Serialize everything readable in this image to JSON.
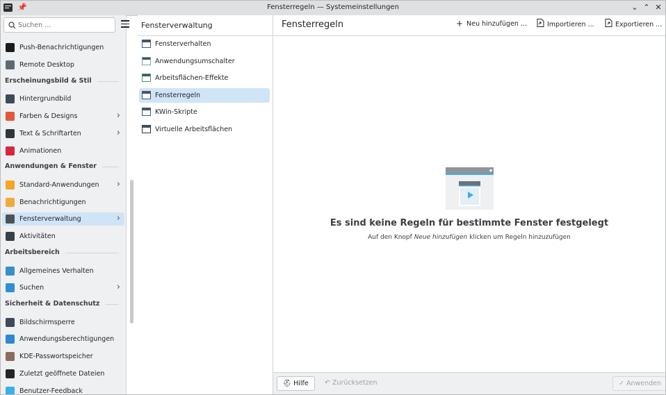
{
  "window": {
    "title": "Fensterregeln — Systemeinstellungen",
    "pin_glyph": "📌",
    "minimize_glyph": "⌄",
    "maximize_glyph": "⌃",
    "close_glyph": "✕"
  },
  "sidebar": {
    "search_placeholder": "Suchen ...",
    "items": [
      {
        "kind": "item",
        "label": "Push-Benachrichtigungen",
        "icon": "push-notification-icon",
        "color": "#1b1b1b"
      },
      {
        "kind": "item",
        "label": "Remote Desktop",
        "icon": "remote-desktop-icon",
        "color": "#5e6a73"
      },
      {
        "kind": "section",
        "label": "Erscheinungsbild & Stil"
      },
      {
        "kind": "item",
        "label": "Hintergrundbild",
        "icon": "wallpaper-icon",
        "color": "#3c4a5a"
      },
      {
        "kind": "item",
        "label": "Farben & Designs",
        "icon": "colors-icon",
        "color": "#e2583e",
        "chevron": true
      },
      {
        "kind": "item",
        "label": "Text & Schriftarten",
        "icon": "fonts-icon",
        "color": "#31363b",
        "chevron": true
      },
      {
        "kind": "item",
        "label": "Animationen",
        "icon": "animations-icon",
        "color": "#d9263e"
      },
      {
        "kind": "section",
        "label": "Anwendungen & Fenster"
      },
      {
        "kind": "item",
        "label": "Standard-Anwendungen",
        "icon": "star-icon",
        "color": "#f5a623",
        "chevron": true
      },
      {
        "kind": "item",
        "label": "Benachrichtigungen",
        "icon": "bell-icon",
        "color": "#f2a93b"
      },
      {
        "kind": "item",
        "label": "Fensterverwaltung",
        "icon": "window-management-icon",
        "color": "#4b5257",
        "chevron": true,
        "selected": true
      },
      {
        "kind": "item",
        "label": "Aktivitäten",
        "icon": "activities-icon",
        "color": "#3a4048"
      },
      {
        "kind": "section",
        "label": "Arbeitsbereich"
      },
      {
        "kind": "item",
        "label": "Allgemeines Verhalten",
        "icon": "general-behavior-icon",
        "color": "#3b8fc7"
      },
      {
        "kind": "item",
        "label": "Suchen",
        "icon": "search-settings-icon",
        "color": "#2f8fd8",
        "chevron": true
      },
      {
        "kind": "section",
        "label": "Sicherheit & Datenschutz"
      },
      {
        "kind": "item",
        "label": "Bildschirmsperre",
        "icon": "screen-lock-icon",
        "color": "#3c4a5a"
      },
      {
        "kind": "item",
        "label": "Anwendungsberechtigungen",
        "icon": "permissions-icon",
        "color": "#2f86d6"
      },
      {
        "kind": "item",
        "label": "KDE-Passwortspeicher",
        "icon": "wallet-icon",
        "color": "#8a6d5a"
      },
      {
        "kind": "item",
        "label": "Zuletzt geöffnete Dateien",
        "icon": "recent-files-icon",
        "color": "#232629"
      },
      {
        "kind": "item",
        "label": "Benutzer-Feedback",
        "icon": "feedback-icon",
        "color": "#3daee9"
      }
    ]
  },
  "middle": {
    "title": "Fensterverwaltung",
    "items": [
      {
        "label": "Fensterverhalten",
        "icon": "window-behavior-icon",
        "color": "#3c5a7a"
      },
      {
        "label": "Anwendungsumschalter",
        "icon": "task-switcher-icon",
        "color": "#7a9ab5"
      },
      {
        "label": "Arbeitsflächen-Effekte",
        "icon": "desktop-effects-icon",
        "color": "#2fa37a"
      },
      {
        "label": "Fensterregeln",
        "icon": "window-rules-icon",
        "color": "#3c5a7a",
        "selected": true
      },
      {
        "label": "KWin-Skripte",
        "icon": "kwin-scripts-icon",
        "color": "#3c5a7a"
      },
      {
        "label": "Virtuelle Arbeitsflächen",
        "icon": "virtual-desktops-icon",
        "color": "#2b3a4a"
      }
    ]
  },
  "main": {
    "title": "Fensterregeln",
    "buttons": {
      "new": "Neu hinzufügen ...",
      "import": "Importieren ...",
      "export": "Exportieren ..."
    },
    "empty": {
      "title": "Es sind keine Regeln für bestimmte Fenster festgelegt",
      "sub_prefix": "Auf den Knopf",
      "sub_emph": "Neue hinzufügen",
      "sub_suffix": "klicken um Regeln hinzuzufügen"
    },
    "footer": {
      "help": "Hilfe",
      "reset": "Zurücksetzen",
      "apply": "Anwenden"
    }
  }
}
